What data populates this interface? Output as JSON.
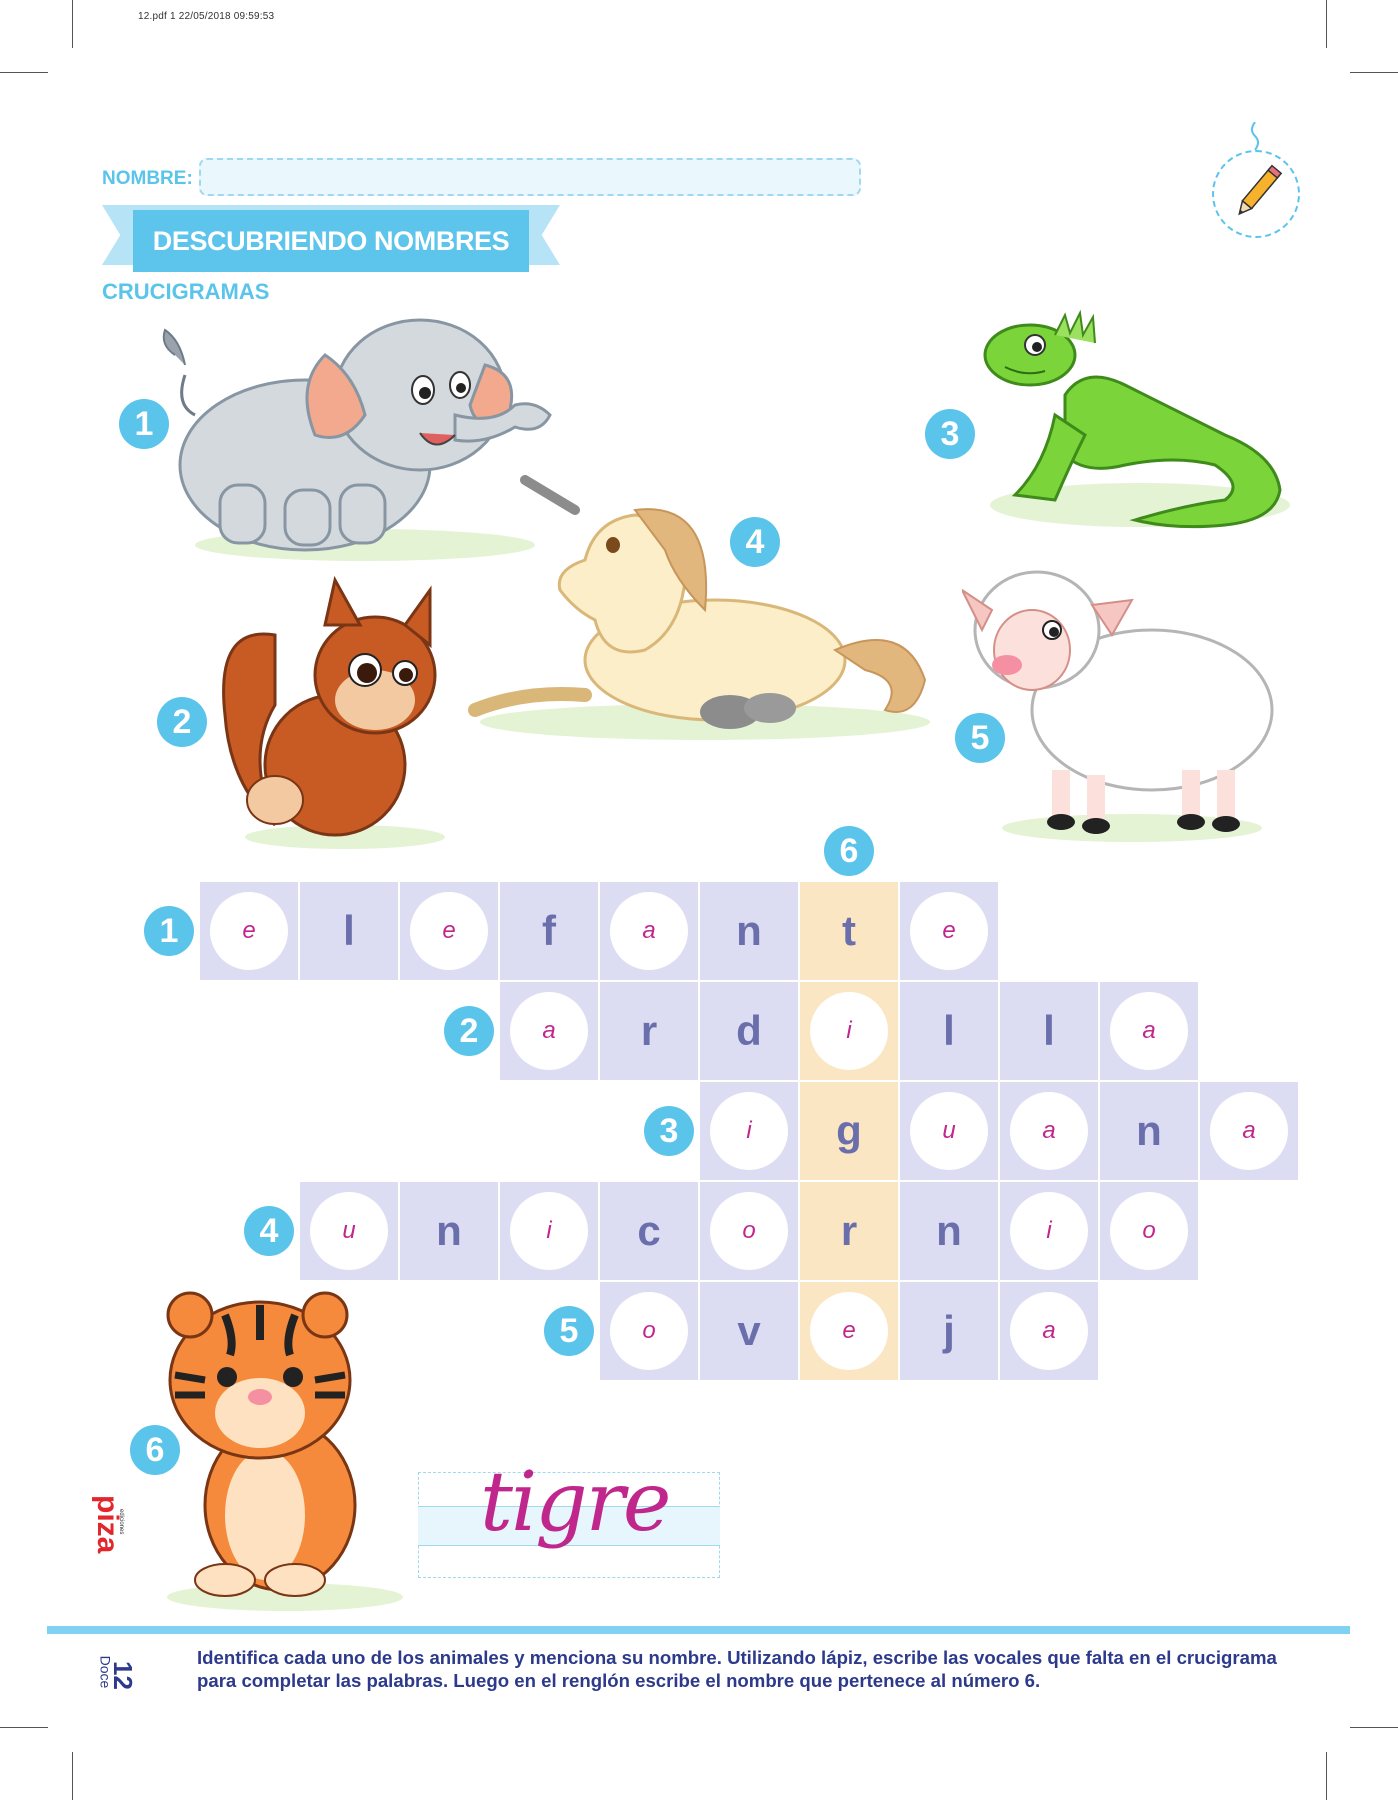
{
  "meta": {
    "file_stamp": "12.pdf  1  22/05/2018  09:59:53"
  },
  "header": {
    "name_label": "NOMBRE:",
    "title": "DESCUBRIENDO NOMBRES",
    "subtitle": "CRUCIGRAMAS",
    "pencil_icon": "pencil-icon"
  },
  "animals": [
    {
      "number": "1",
      "animal": "elephant"
    },
    {
      "number": "2",
      "animal": "squirrel"
    },
    {
      "number": "3",
      "animal": "iguana"
    },
    {
      "number": "4",
      "animal": "unicorn"
    },
    {
      "number": "5",
      "animal": "sheep"
    },
    {
      "number": "6",
      "animal": "tiger"
    }
  ],
  "crossword": {
    "clue_numbers": [
      "1",
      "2",
      "3",
      "4",
      "5",
      "6"
    ],
    "rows": [
      {
        "number": "1",
        "cells": [
          {
            "l": "e",
            "v": true
          },
          {
            "l": "l",
            "v": false
          },
          {
            "l": "e",
            "v": true
          },
          {
            "l": "f",
            "v": false
          },
          {
            "l": "a",
            "v": true
          },
          {
            "l": "n",
            "v": false
          },
          {
            "l": "t",
            "v": false
          },
          {
            "l": "e",
            "v": true
          }
        ]
      },
      {
        "number": "2",
        "cells": [
          {
            "l": "a",
            "v": true
          },
          {
            "l": "r",
            "v": false
          },
          {
            "l": "d",
            "v": false
          },
          {
            "l": "i",
            "v": true
          },
          {
            "l": "l",
            "v": false
          },
          {
            "l": "l",
            "v": false
          },
          {
            "l": "a",
            "v": true
          }
        ]
      },
      {
        "number": "3",
        "cells": [
          {
            "l": "i",
            "v": true
          },
          {
            "l": "g",
            "v": false
          },
          {
            "l": "u",
            "v": true
          },
          {
            "l": "a",
            "v": true
          },
          {
            "l": "n",
            "v": false
          },
          {
            "l": "a",
            "v": true
          }
        ]
      },
      {
        "number": "4",
        "cells": [
          {
            "l": "u",
            "v": true
          },
          {
            "l": "n",
            "v": false
          },
          {
            "l": "i",
            "v": true
          },
          {
            "l": "c",
            "v": false
          },
          {
            "l": "o",
            "v": true
          },
          {
            "l": "r",
            "v": false
          },
          {
            "l": "n",
            "v": false
          },
          {
            "l": "i",
            "v": true
          },
          {
            "l": "o",
            "v": true
          }
        ]
      },
      {
        "number": "5",
        "cells": [
          {
            "l": "o",
            "v": true
          },
          {
            "l": "v",
            "v": false
          },
          {
            "l": "e",
            "v": true
          },
          {
            "l": "j",
            "v": false
          },
          {
            "l": "a",
            "v": true
          }
        ]
      }
    ]
  },
  "answer": {
    "text": "tigre"
  },
  "footer": {
    "instructions": "Identifica cada uno de los animales y menciona su nombre. Utilizando lápiz, escribe las vocales que falta en el crucigrama para completar las palabras. Luego en el renglón escribe el nombre que pertenece al número 6.",
    "page_number": "12",
    "page_word": "Doce",
    "publisher": "piza",
    "publisher_sub": "ediciones"
  },
  "colors": {
    "accent": "#5bc4ea",
    "cell": "#dcdcf2",
    "highlight_column": "#fbe6c4",
    "vowel": "#c0278d",
    "consonant": "#6a6eab",
    "text_dark": "#2d3a8c"
  }
}
